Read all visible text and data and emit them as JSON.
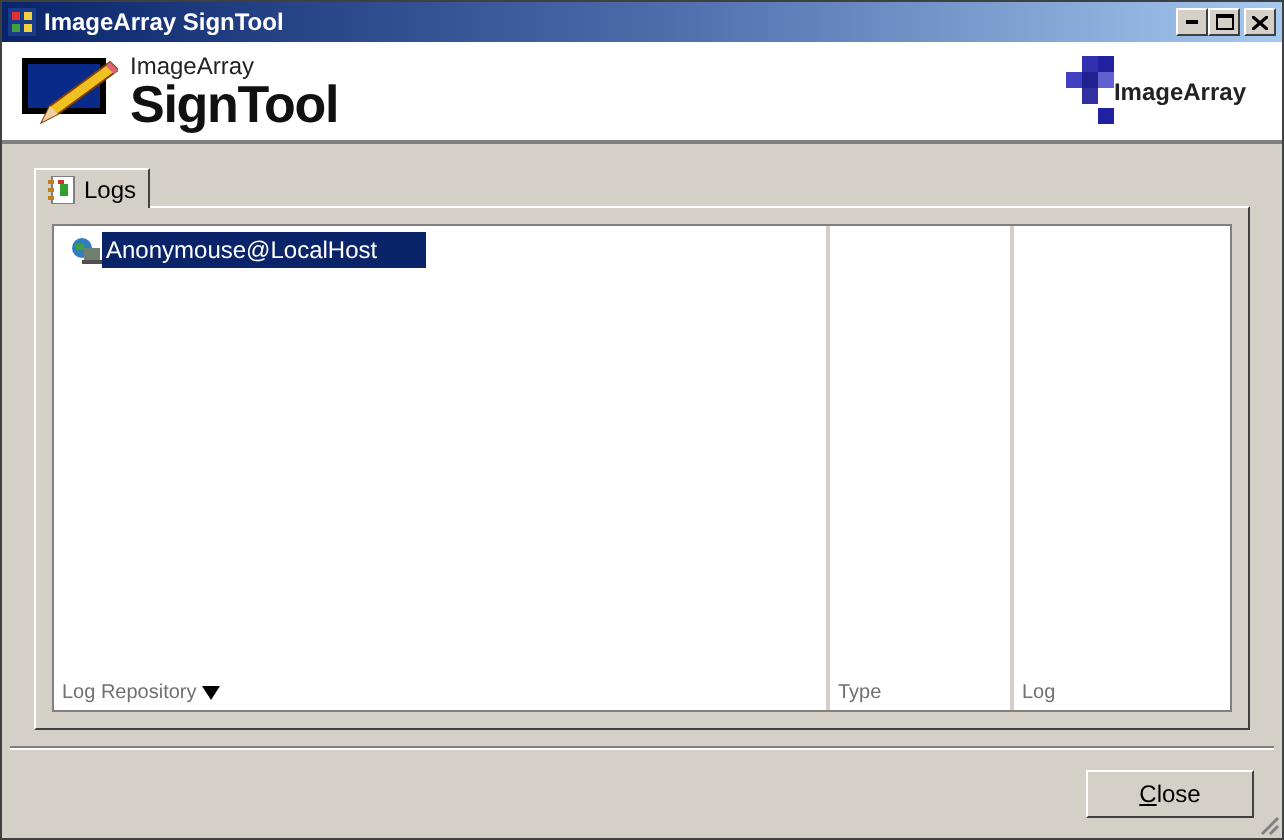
{
  "window": {
    "title": "ImageArray SignTool"
  },
  "header": {
    "product_small": "ImageArray",
    "product_large": "SignTool",
    "brand": "ImageArray"
  },
  "tabs": [
    {
      "label": "Logs",
      "selected": true
    }
  ],
  "tree": [
    {
      "label": "Anonymouse@LocalHost",
      "selected": true
    }
  ],
  "columns": [
    {
      "label": "Log Repository",
      "filter": true
    },
    {
      "label": "Type",
      "filter": false
    },
    {
      "label": "Log",
      "filter": false
    }
  ],
  "buttons": [
    {
      "label": "Close"
    }
  ]
}
